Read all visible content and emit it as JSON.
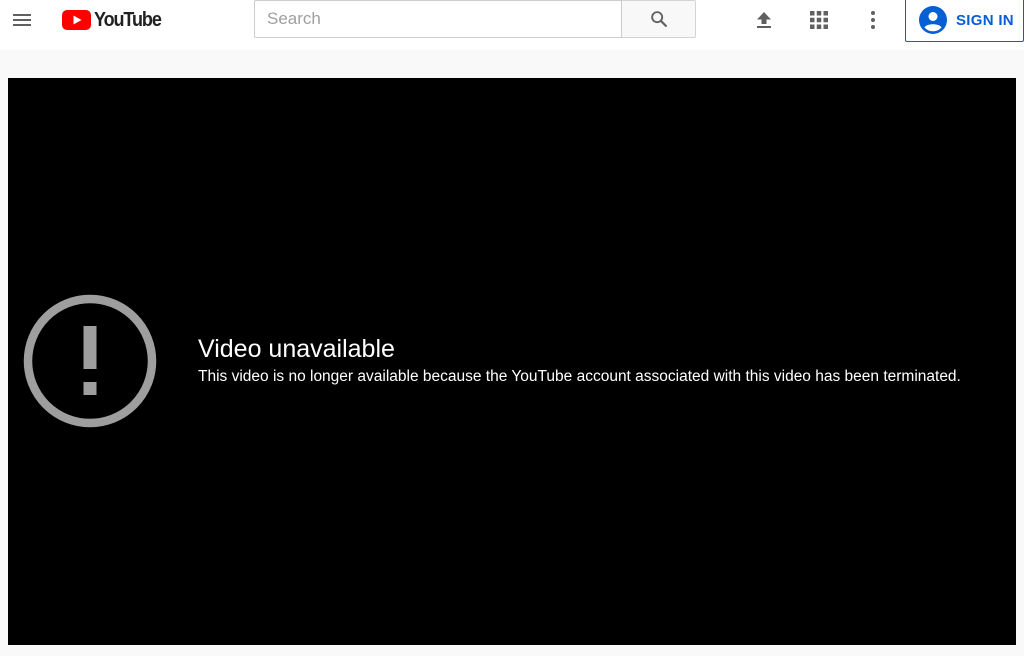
{
  "header": {
    "logo_text": "YouTube",
    "search": {
      "placeholder": "Search",
      "value": ""
    },
    "signin_label": "SIGN IN",
    "icons": {
      "menu": "hamburger-menu-icon",
      "search": "search-icon",
      "upload": "upload-icon",
      "apps": "apps-grid-icon",
      "more": "more-vert-icon",
      "account": "account-circle-icon"
    }
  },
  "player": {
    "error_title": "Video unavailable",
    "error_reason": "This video is no longer available because the YouTube account associated with this video has been terminated.",
    "error_icon": "alert-circle-icon"
  },
  "colors": {
    "brand_red": "#ff0000",
    "link_blue": "#065fd4",
    "player_bg": "#000000",
    "icon_gray": "#606060",
    "error_icon_gray": "#9e9e9e"
  }
}
